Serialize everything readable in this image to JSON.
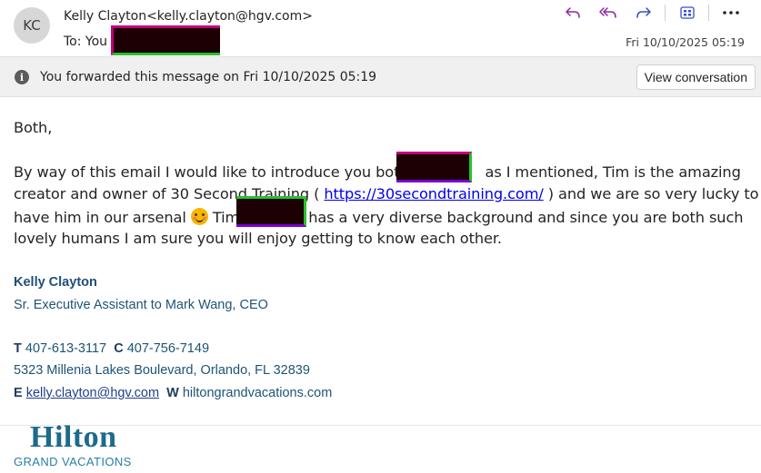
{
  "message": {
    "avatar_initials": "KC",
    "from_name": "Kelly Clayton",
    "from_email": "<kelly.clayton@hgv.com>",
    "to_label": "To:",
    "to_value": "You",
    "date": "Fri 10/10/2025 05:19",
    "toolbar_icons": [
      "reply-icon",
      "reply-all-icon",
      "forward-icon",
      "apps-icon",
      "more-icon"
    ]
  },
  "banner": {
    "text": "You forwarded this message on Fri 10/10/2025 05:19",
    "button": "View conversation"
  },
  "body": {
    "greeting": "Both,",
    "p1_a": "By way of this email I would like to introduce you both",
    "p1_b": "as I mentioned, Tim is the amazing",
    "p2_a": "creator and owner of 30 Second Training ( ",
    "link": "https://30secondtraining.com/",
    "p2_b": " )  and we are so very lucky to",
    "p3_a": "have him in our arsenal ",
    "p3_b": " Tim",
    "p3_c": "has a very diverse background and since you are both such",
    "p4": "lovely humans I am sure you will enjoy getting to know each other."
  },
  "signature": {
    "name": "Kelly Clayton",
    "title": "Sr. Executive Assistant to Mark Wang, CEO",
    "t_label": "T",
    "t_value": "407-613-3117",
    "c_label": "C",
    "c_value": "407-756-7149",
    "address": "5323 Millenia Lakes Boulevard, Orlando, FL 32839",
    "e_label": "E",
    "e_value": "kelly.clayton@hgv.com",
    "w_label": "W",
    "w_value": "hiltongrandvacations.com"
  },
  "logo": {
    "line1": "Hilton",
    "line2": "GRAND VACATIONS"
  },
  "colors": {
    "link": "#0000ee",
    "signature": "#1f5377",
    "logo": "#1d6a8a",
    "redaction_fill": "#1c0004"
  }
}
